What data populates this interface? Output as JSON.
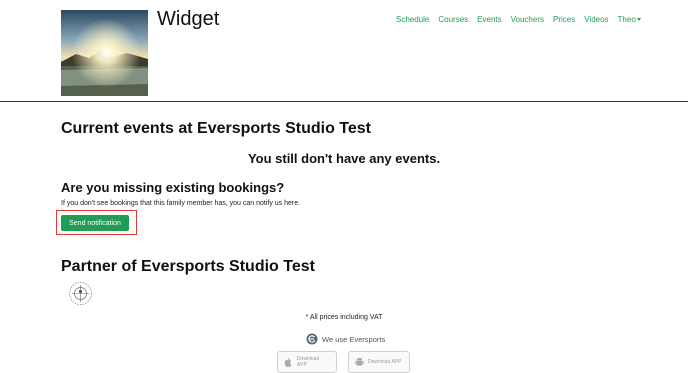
{
  "header": {
    "title": "Widget",
    "nav": [
      "Schedule",
      "Courses",
      "Events",
      "Vouchers",
      "Prices",
      "Videos"
    ],
    "user_menu": "Theo"
  },
  "main": {
    "heading": "Current events at Eversports Studio Test",
    "empty_message": "You still don't have any events.",
    "missing_heading": "Are you missing existing bookings?",
    "missing_hint": "If you don't see bookings that this family member has, you can notify us here.",
    "send_button": "Send notification",
    "partner_heading": "Partner of Eversports Studio Test"
  },
  "footer": {
    "vat_note": "* All prices including VAT",
    "use_text": "We use Eversports",
    "app_store": "Download APP",
    "play_store": "Download APP"
  },
  "colors": {
    "accent": "#1f9d55",
    "highlight": "#e53935"
  }
}
